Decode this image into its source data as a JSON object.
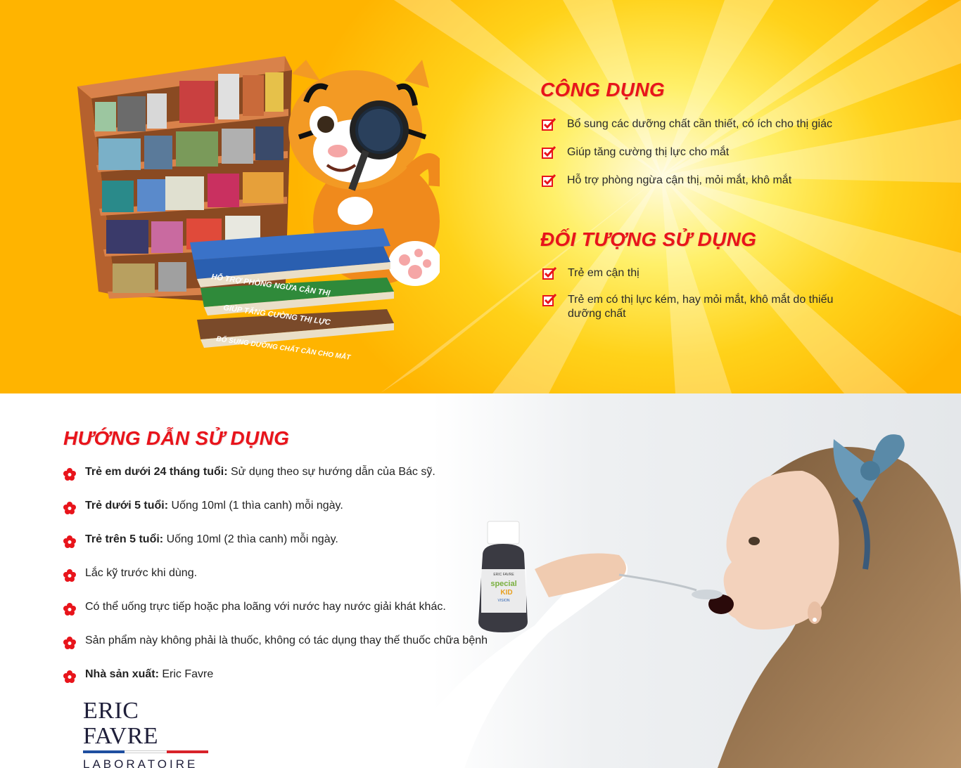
{
  "colors": {
    "accent_red": "#e8141b",
    "yellow_bright": "#fff06a",
    "yellow_deep": "#ffb400",
    "book_blue": "#2a5fb0",
    "book_green": "#2f8a3a",
    "book_brown": "#7a4a2a"
  },
  "illustration": {
    "books": [
      {
        "label": "HỖ TRỢ PHÒNG NGỪA CẬN THỊ",
        "color": "blue"
      },
      {
        "label": "GIÚP TĂNG CƯỜNG THỊ LỰC",
        "color": "green"
      },
      {
        "label": "BỔ SUNG DƯỠNG CHẤT CẦN CHO MẮT",
        "color": "brown"
      }
    ]
  },
  "benefits": {
    "title": "CÔNG DỤNG",
    "items": [
      "Bổ sung các dưỡng chất cần thiết, có ích cho thị giác",
      "Giúp tăng cường thị lực cho mắt",
      "Hỗ trợ phòng ngừa cận thị, mỏi mắt, khô mắt"
    ]
  },
  "target_users": {
    "title": "ĐỐI TƯỢNG SỬ DỤNG",
    "items": [
      "Trẻ em cận thị",
      "Trẻ em có thị lực kém, hay mỏi mắt, khô mắt do thiếu dưỡng chất"
    ]
  },
  "instructions": {
    "title": "HƯỚNG DẪN SỬ DỤNG",
    "items": [
      {
        "label": "Trẻ em dưới 24 tháng tuổi:",
        "text": " Sử dụng theo sự hướng dẫn của Bác sỹ."
      },
      {
        "label": "Trẻ dưới 5 tuổi:",
        "text": " Uống 10ml (1 thìa canh) mỗi ngày."
      },
      {
        "label": "Trẻ trên 5 tuổi:",
        "text": " Uống 10ml (2 thìa canh) mỗi ngày."
      },
      {
        "label": "",
        "text": "Lắc kỹ trước khi dùng."
      },
      {
        "label": "",
        "text": "Có thể uống trực tiếp hoặc pha loãng với nước hay nước giải khát khác."
      },
      {
        "label": "",
        "text": "Sản phẩm này không phải là thuốc, không có tác dụng thay thế thuốc chữa bệnh"
      },
      {
        "label": "Nhà sản xuất:",
        "text": " Eric Favre"
      }
    ]
  },
  "product": {
    "bottle_brand": "ERIC FAVRE",
    "bottle_name_1": "special",
    "bottle_name_2": "KID",
    "bottle_variant": "VISION"
  },
  "logo": {
    "line1": "ERIC FAVRE",
    "line2": "LABORATOIRE",
    "flag_colors": [
      "#1f4fa0",
      "#ffffff",
      "#d8232a"
    ]
  }
}
